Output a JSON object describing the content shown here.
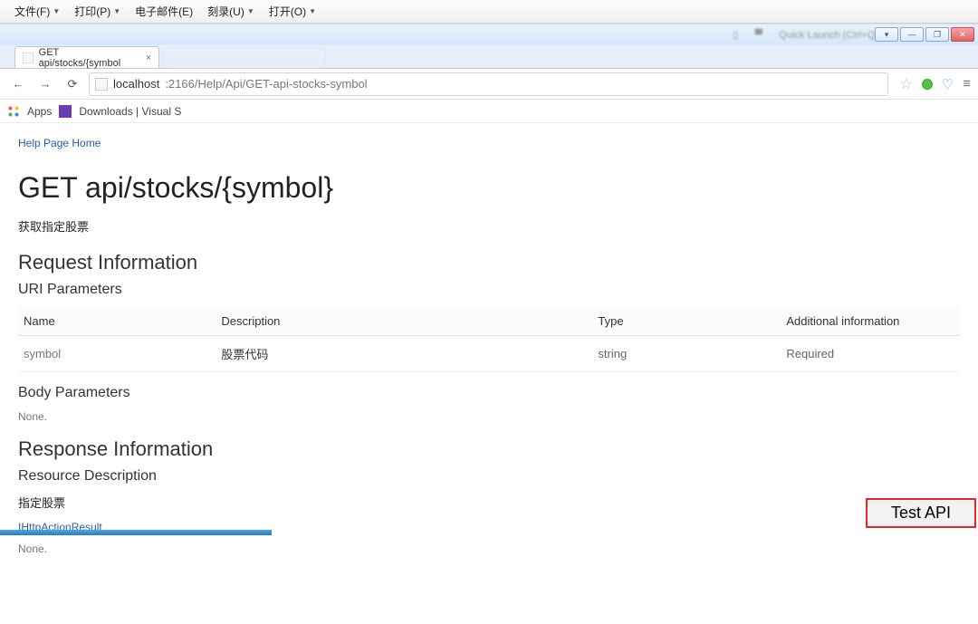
{
  "menu": {
    "file": "文件(F)",
    "print": "打印(P)",
    "email": "电子邮件(E)",
    "burn": "刻录(U)",
    "open": "打开(O)"
  },
  "window": {
    "search_placeholder": "Quick Launch (Ctrl+Q)"
  },
  "tab": {
    "title": "GET api/stocks/{symbol"
  },
  "addr": {
    "host": "localhost",
    "port_path": ":2166/Help/Api/GET-api-stocks-symbol"
  },
  "bookmarks": {
    "apps": "Apps",
    "downloads": "Downloads | Visual S"
  },
  "page": {
    "crumb": "Help Page Home",
    "title": "GET api/stocks/{symbol}",
    "desc": "获取指定股票",
    "request_info": "Request Information",
    "uri_params": "URI Parameters",
    "cols": {
      "name": "Name",
      "description": "Description",
      "type": "Type",
      "add": "Additional information"
    },
    "row1": {
      "name": "symbol",
      "description": "股票代码",
      "type": "string",
      "add": "Required"
    },
    "body_params": "Body Parameters",
    "none": "None.",
    "response_info": "Response Information",
    "resource_desc": "Resource Description",
    "resource_text": "指定股票",
    "result_type": "IHttpActionResult",
    "none2": "None.",
    "test_api": "Test API"
  }
}
